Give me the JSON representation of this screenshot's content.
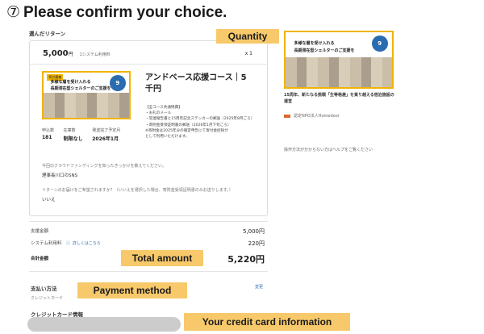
{
  "heading": {
    "number": "⑦",
    "text": "Please confirm your choice."
  },
  "selected_return": {
    "label": "選んだリターン",
    "price": "5,000",
    "yen": "円",
    "fee_note": "1システム利用料",
    "quantity": "x 1",
    "thumb_tag": "寄付募集",
    "thumb_line1": "多様な層を受け入れる",
    "thumb_line2": "長期滞在型シェルターのご支援を",
    "thumb_badge": "9",
    "course_title": "アンドベース応援コース｜5千円",
    "course_desc": [
      "【全コース共通特典】",
      "・お礼のメール",
      "・常連報告書と15周年記念ステッカーの郵送（2025年8月ごろ）",
      "・寄附金受領証明書の郵送（2026年1月下旬ごろ）",
      "※寄附金は2025年分の確定申告にて寄付金控除が",
      "として利用いただけます。"
    ],
    "stats": {
      "supporters_label": "申込数",
      "supporters_value": "181",
      "limit_label": "在庫数",
      "limit_value": "制限なし",
      "delivery_label": "発送完了予定月",
      "delivery_value": "2026年1月"
    },
    "q1": "今回のクラウドファンディングを知ったきっかけを教えてください。",
    "a1": "理事長川口のSNS",
    "q2": "リターンのお届けをご希望されますか？（いいえを選択した場合、寄附金受領証明書のみお送りします。）",
    "a2": "いいえ"
  },
  "summary": {
    "support_label": "支援金額",
    "support_value": "5,000円",
    "system_label": "システム利用料",
    "system_link": "詳しくはこちら",
    "system_value": "220円",
    "total_label": "合計金額",
    "total_value": "5,220円"
  },
  "payment": {
    "label": "支払い方法",
    "change": "変更",
    "method": "クレジットカード",
    "card_label": "クレジットカード情報"
  },
  "callouts": {
    "quantity": "Quantity",
    "total": "Total amount",
    "payment": "Payment method",
    "card": "Your credit card information"
  },
  "sidebar": {
    "thumb_line1": "多様な層を受け入れる",
    "thumb_line2": "長期滞在型シェルターのご支援を",
    "thumb_badge": "9",
    "title": "15周年、新たなる挑戦「生等格差」を乗り越える宿泊施設の運営",
    "org": "認定NPO法人Homedoor",
    "help": "操作方法が分からない方はヘルプをご覧ください"
  },
  "colors": {
    "accent": "#f7c96b",
    "link": "#2b6cb0",
    "thumb_border": "#f0b400"
  }
}
